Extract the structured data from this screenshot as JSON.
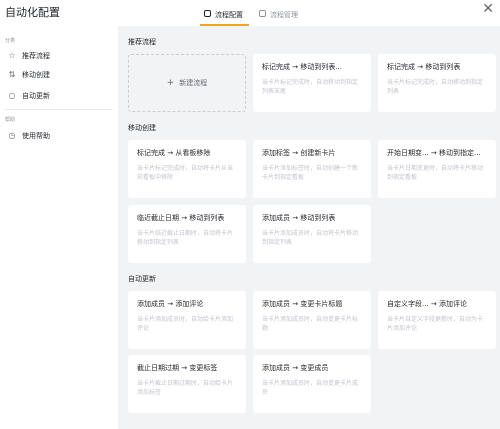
{
  "header": {
    "title": "自动化配置",
    "tabs": [
      {
        "label": "流程配置",
        "active": true
      },
      {
        "label": "流程管理",
        "active": false
      }
    ],
    "close_icon": "close-icon"
  },
  "sidebar": {
    "sections": [
      {
        "label": "分类",
        "items": [
          {
            "label": "推荐流程",
            "icon": "star-icon"
          },
          {
            "label": "移动创建",
            "icon": "transfer-icon"
          },
          {
            "label": "自动更新",
            "icon": "circle-icon"
          }
        ]
      },
      {
        "label": "帮助",
        "items": [
          {
            "label": "使用帮助",
            "icon": "clock-icon"
          }
        ]
      }
    ]
  },
  "main": {
    "groups": [
      {
        "title": "推荐流程",
        "new_card_label": "新建流程",
        "cards": [
          {
            "title": "标记完成 → 移动到列表...",
            "desc": "当卡片标记完成时，自动移动到指定列表末尾"
          },
          {
            "title": "标记完成 → 移动到列表",
            "desc": "当卡片标记完成时，自动移动到指定列表"
          }
        ]
      },
      {
        "title": "移动创建",
        "cards": [
          {
            "title": "标记完成 → 从看板移除",
            "desc": "当卡片标记完成时，自动将卡片从当前看板中移除"
          },
          {
            "title": "添加标签 → 创建新卡片",
            "desc": "当卡片添加标签时，自动创建一个新卡片到指定看板"
          },
          {
            "title": "开始日期变... → 移动到指定...",
            "desc": "当卡片日期变更时，自动将卡片移动到指定看板"
          },
          {
            "title": "临近截止日期 → 移动到列表",
            "desc": "当卡片临近截止日期时，自动将卡片移动到指定列表"
          },
          {
            "title": "添加成员 → 移动到列表",
            "desc": "当卡片添加成员时，自动将卡片移动到指定列表"
          }
        ]
      },
      {
        "title": "自动更新",
        "cards": [
          {
            "title": "添加成员 → 添加评论",
            "desc": "当卡片添加成员时，自动给卡片添加评论"
          },
          {
            "title": "添加成员 → 变更卡片标题",
            "desc": "当卡片添加成员时，自动变更卡片标题"
          },
          {
            "title": "自定义字段... → 添加评论",
            "desc": "当卡片自定义字段更新时，自动为卡片添加评论"
          },
          {
            "title": "截止日期过期 → 变更标签",
            "desc": "当卡片截止日期过期时，自动给卡片添加标签"
          },
          {
            "title": "添加成员 → 变更成员",
            "desc": "当卡片添加成员时，自动变更卡片成员"
          }
        ]
      }
    ]
  }
}
